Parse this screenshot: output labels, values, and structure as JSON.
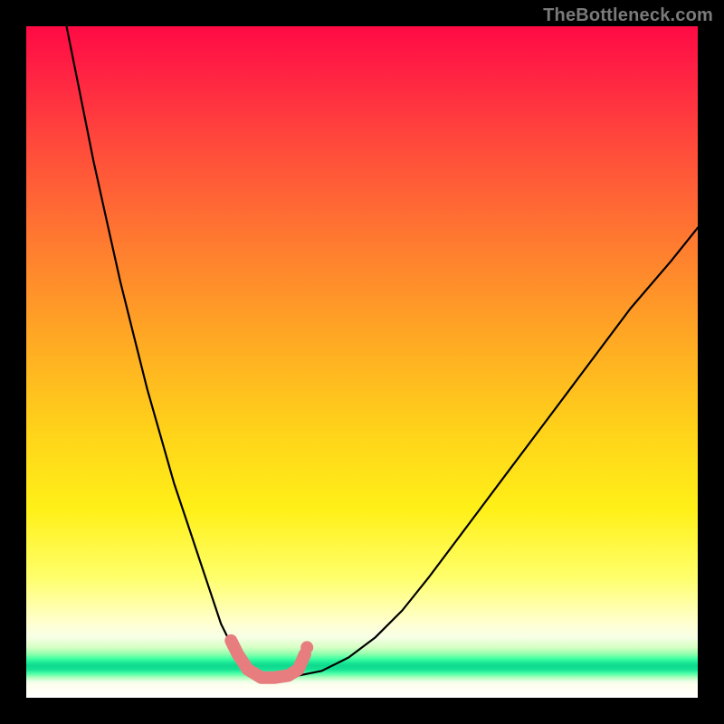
{
  "watermark": "TheBottleneck.com",
  "colors": {
    "background_frame": "#000000",
    "watermark_text": "#7a7a7a",
    "curve": "#000000",
    "marker": "#e77d7e",
    "gradient_top": "#ff0a44",
    "gradient_mid": "#ffd21a",
    "gradient_green": "#18e896",
    "gradient_bottom": "#ffffff"
  },
  "chart_data": {
    "type": "line",
    "title": "",
    "xlabel": "",
    "ylabel": "",
    "xlim": [
      0,
      100
    ],
    "ylim": [
      0,
      100
    ],
    "grid": false,
    "legend": false,
    "series": [
      {
        "name": "bottleneck-curve-left",
        "x": [
          6,
          8,
          10,
          12,
          14,
          16,
          18,
          20,
          22,
          24,
          26,
          28,
          29,
          30,
          31,
          32,
          33,
          34,
          35
        ],
        "y": [
          100,
          90,
          80,
          71,
          62,
          54,
          46,
          39,
          32,
          26,
          20,
          14,
          11,
          9,
          7,
          5.5,
          4.3,
          3.4,
          3
        ]
      },
      {
        "name": "bottleneck-curve-right",
        "x": [
          35,
          37,
          40,
          44,
          48,
          52,
          56,
          60,
          66,
          72,
          78,
          84,
          90,
          96,
          100
        ],
        "y": [
          3,
          3,
          3.2,
          4,
          6,
          9,
          13,
          18,
          26,
          34,
          42,
          50,
          58,
          65,
          70
        ]
      }
    ],
    "highlight_segment": {
      "name": "optimal-range-marker",
      "x": [
        30.5,
        31.5,
        33,
        35,
        37,
        39,
        40.5,
        41.5
      ],
      "y": [
        8.5,
        6.5,
        4.2,
        3,
        3,
        3.3,
        4.2,
        6.5
      ]
    },
    "highlight_points": [
      {
        "x": 41.8,
        "y": 7.5
      }
    ]
  }
}
